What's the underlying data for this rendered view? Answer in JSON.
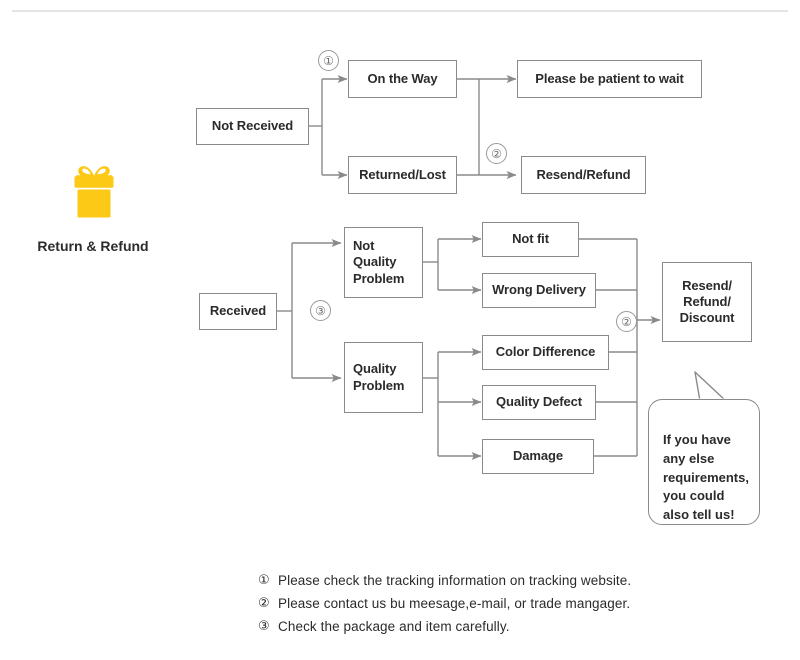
{
  "page": {
    "title": "Return & Refund",
    "top_divider": true,
    "colors": {
      "gift": "#FBC916",
      "box_border": "#8a8a8a",
      "line": "#8a8a8a",
      "text": "#2b2b2b",
      "marker": "#9a9a9a",
      "divider": "#d9d9d9",
      "background": "#ffffff"
    }
  },
  "brand": {
    "icon": "gift-box-icon",
    "label": "Return & Refund"
  },
  "flow": {
    "not_received": {
      "start": "Not Received",
      "branches": [
        {
          "label": "On the Way",
          "marker": "①",
          "result": "Please be patient to wait"
        },
        {
          "label": "Returned/Lost",
          "marker": "②",
          "result": "Resend/Refund"
        }
      ]
    },
    "received": {
      "start": "Received",
      "marker": "③",
      "categories": [
        {
          "label": "Not\nQuality\nProblem",
          "reasons": [
            "Not fit",
            "Wrong Delivery"
          ]
        },
        {
          "label": "Quality\nProblem",
          "reasons": [
            "Color Difference",
            "Quality Defect",
            "Damage"
          ]
        }
      ],
      "outcome_marker": "②",
      "outcome": "Resend/\nRefund/\nDiscount"
    }
  },
  "callout": {
    "text": "If you have\nany else\nrequirements,\nyou could\nalso tell us!"
  },
  "notes": [
    {
      "num": "①",
      "text": "Please check the tracking information on tracking website."
    },
    {
      "num": "②",
      "text": "Please contact us bu meesage,e-mail, or trade mangager."
    },
    {
      "num": "③",
      "text": "Check the package and item carefully."
    }
  ]
}
